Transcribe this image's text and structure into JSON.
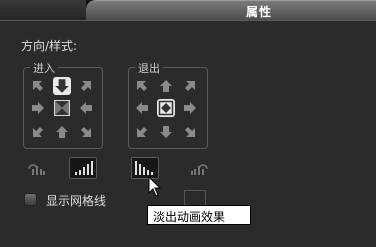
{
  "header": {
    "active_tab": "属性"
  },
  "section_label": "方向/样式:",
  "enter_group": {
    "title": "进入",
    "selected": "top"
  },
  "exit_group": {
    "title": "退出",
    "selected": "center"
  },
  "fade_buttons": {
    "items": [
      "fade-in-left",
      "fade-in",
      "fade-out",
      "fade-out-right"
    ],
    "selected": [
      "fade-in",
      "fade-out"
    ],
    "hovered": "fade-out"
  },
  "grid_checkbox": {
    "label": "显示网格线",
    "checked": false
  },
  "tooltip": {
    "text": "淡出动画效果"
  }
}
